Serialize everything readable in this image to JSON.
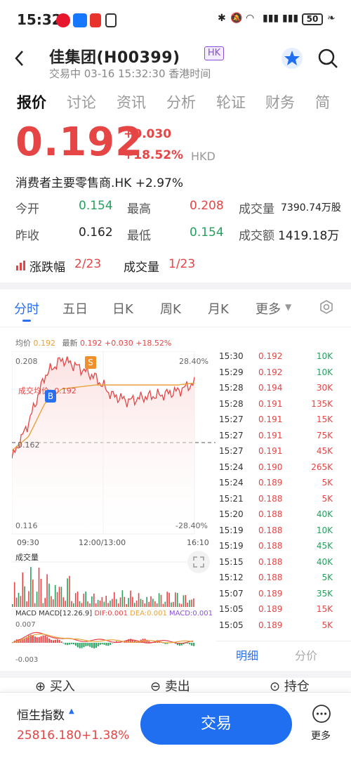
{
  "status": {
    "time": "15:32",
    "battery": "50",
    "app_icons": [
      "weibo-icon",
      "alipay-icon",
      "mail-icon",
      "nfc-icon"
    ]
  },
  "header": {
    "title": "佳集团(H00399)",
    "market_badge": "HK",
    "subtitle": "交易中 03-16 15:32:30 香港时间"
  },
  "tabs": [
    "报价",
    "讨论",
    "资讯",
    "分析",
    "轮证",
    "财务",
    "简"
  ],
  "quote": {
    "price": "0.192",
    "change": "+0.030",
    "change_pct": "+18.52%",
    "currency": "HKD",
    "sector": "消费者主要零售商.HK +2.97%",
    "open_label": "今开",
    "open": "0.154",
    "high_label": "最高",
    "high": "0.208",
    "volume_label": "成交量",
    "volume": "7390.74万股",
    "prev_label": "昨收",
    "prev": "0.162",
    "low_label": "最低",
    "low": "0.154",
    "turnover_label": "成交额",
    "turnover": "1419.18万",
    "rank1_label": "涨跌幅",
    "rank1": "2/23",
    "rank2_label": "成交量",
    "rank2": "1/23"
  },
  "chart_tabs": [
    "分时",
    "五日",
    "日K",
    "周K",
    "月K",
    "更多"
  ],
  "chart_info": {
    "avg_label": "均价",
    "avg": "0.192",
    "last_label": "最新",
    "last": "0.192",
    "last_chg": "+0.030",
    "last_pct": "+18.52%"
  },
  "chart_labels": {
    "y_top": "0.208",
    "y_mid": "0.162",
    "y_bot": "0.116",
    "pct_top": "28.40%",
    "pct_bot": "-28.40%",
    "avg_line": "成交均价: 0.192",
    "x_start": "09:30",
    "x_mid": "12:00/13:00",
    "x_end": "16:10",
    "volume_title": "成交量",
    "macd_title": "MACD",
    "macd_params": "MACD[12.26.9]",
    "dif": "DIF:0.001",
    "dea": "DEA:0.001",
    "macd": "MACD:0.001",
    "macd_top": "0.007",
    "macd_bot": "-0.003",
    "marker_s": "S",
    "marker_b": "B"
  },
  "chart_data": {
    "type": "line",
    "x": [
      "09:30",
      "10:00",
      "10:30",
      "11:00",
      "11:30",
      "12:00",
      "13:30",
      "14:00",
      "14:30",
      "15:00",
      "15:30",
      "16:10"
    ],
    "series": [
      {
        "name": "最新",
        "values": [
          0.154,
          0.172,
          0.196,
          0.204,
          0.2,
          0.195,
          0.186,
          0.183,
          0.185,
          0.186,
          0.188,
          0.192
        ]
      },
      {
        "name": "均价",
        "values": [
          0.158,
          0.165,
          0.182,
          0.189,
          0.19,
          0.191,
          0.191,
          0.191,
          0.191,
          0.191,
          0.191,
          0.192
        ]
      }
    ],
    "ylim": [
      0.116,
      0.208
    ]
  },
  "trades": [
    {
      "t": "15:30",
      "p": "0.192",
      "v": "10K",
      "c": "g"
    },
    {
      "t": "15:29",
      "p": "0.192",
      "v": "10K",
      "c": "g"
    },
    {
      "t": "15:28",
      "p": "0.194",
      "v": "30K",
      "c": "r"
    },
    {
      "t": "15:28",
      "p": "0.191",
      "v": "135K",
      "c": "r"
    },
    {
      "t": "15:27",
      "p": "0.191",
      "v": "15K",
      "c": "r"
    },
    {
      "t": "15:27",
      "p": "0.191",
      "v": "75K",
      "c": "r"
    },
    {
      "t": "15:27",
      "p": "0.191",
      "v": "45K",
      "c": "r"
    },
    {
      "t": "15:24",
      "p": "0.190",
      "v": "265K",
      "c": "r"
    },
    {
      "t": "15:24",
      "p": "0.189",
      "v": "5K",
      "c": "r"
    },
    {
      "t": "15:21",
      "p": "0.188",
      "v": "5K",
      "c": "r"
    },
    {
      "t": "15:20",
      "p": "0.188",
      "v": "40K",
      "c": "g"
    },
    {
      "t": "15:19",
      "p": "0.188",
      "v": "10K",
      "c": "g"
    },
    {
      "t": "15:19",
      "p": "0.188",
      "v": "45K",
      "c": "g"
    },
    {
      "t": "15:15",
      "p": "0.188",
      "v": "40K",
      "c": "g"
    },
    {
      "t": "15:12",
      "p": "0.188",
      "v": "5K",
      "c": "g"
    },
    {
      "t": "15:07",
      "p": "0.189",
      "v": "35K",
      "c": "g"
    },
    {
      "t": "15:05",
      "p": "0.189",
      "v": "15K",
      "c": "r"
    },
    {
      "t": "15:05",
      "p": "0.189",
      "v": "5K",
      "c": "r"
    }
  ],
  "mini_tabs": [
    "明细",
    "分价"
  ],
  "actions": [
    "买入",
    "卖出",
    "持仓"
  ],
  "bottom": {
    "index_name": "恒生指数",
    "index_value": "25816.180",
    "index_chg": "+1.38%",
    "trade_label": "交易",
    "more_label": "更多"
  },
  "colors": {
    "up": "#e54545",
    "down": "#24a15e",
    "accent": "#1f6ff0"
  }
}
